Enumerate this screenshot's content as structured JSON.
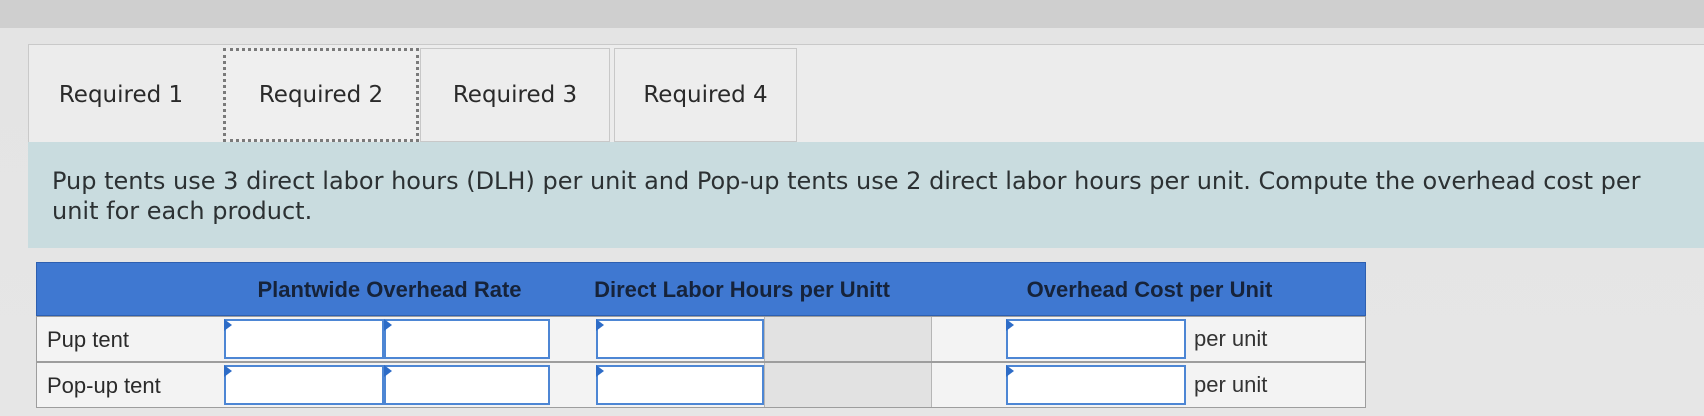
{
  "tabs": [
    {
      "label": "Required 1",
      "active": false
    },
    {
      "label": "Required 2",
      "active": true
    },
    {
      "label": "Required 3",
      "active": false
    },
    {
      "label": "Required 4",
      "active": false
    }
  ],
  "instruction": "Pup tents use 3 direct labor hours (DLH) per unit and Pop-up tents use 2 direct labor hours per unit. Compute the overhead cost per unit for each product.",
  "table": {
    "headers": [
      "",
      "Plantwide Overhead Rate",
      "Direct Labor Hours per Unitt",
      "Overhead Cost per Unit"
    ],
    "rows": [
      {
        "label": "Pup tent",
        "unit_label": "per unit",
        "rate": "",
        "rate2": "",
        "dlh": "",
        "cost": ""
      },
      {
        "label": "Pop-up tent",
        "unit_label": "per unit",
        "rate": "",
        "rate2": "",
        "dlh": "",
        "cost": ""
      }
    ]
  },
  "colors": {
    "header_bg": "#3f78d1",
    "instruction_bg": "#c9dcdf",
    "input_border": "#4d86d4"
  }
}
